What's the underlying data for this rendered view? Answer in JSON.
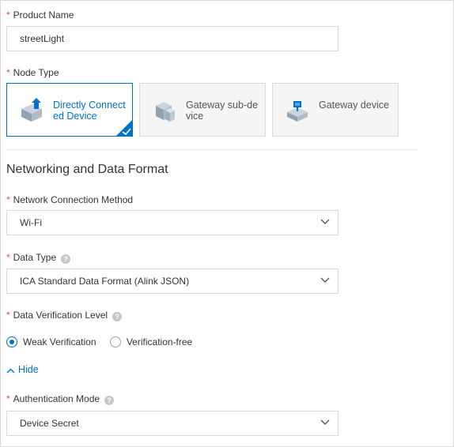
{
  "form": {
    "product_name": {
      "required_mark": "*",
      "label": "Product Name",
      "value": "streetLight"
    },
    "node_type": {
      "required_mark": "*",
      "label": "Node Type",
      "options": [
        {
          "label": "Directly Connected Device",
          "icon": "direct-device-icon",
          "selected": true
        },
        {
          "label": "Gateway sub-device",
          "icon": "gateway-subdevice-icon",
          "selected": false
        },
        {
          "label": "Gateway device",
          "icon": "gateway-device-icon",
          "selected": false
        }
      ]
    },
    "section_title": "Networking and Data Format",
    "network_connection": {
      "required_mark": "*",
      "label": "Network Connection Method",
      "value": "Wi-Fi"
    },
    "data_type": {
      "required_mark": "*",
      "label": "Data Type",
      "value": "ICA Standard Data Format (Alink JSON)",
      "help": "?"
    },
    "data_verification": {
      "required_mark": "*",
      "label": "Data Verification Level",
      "help": "?",
      "options": [
        {
          "label": "Weak Verification",
          "checked": true
        },
        {
          "label": "Verification-free",
          "checked": false
        }
      ]
    },
    "hide_link": "Hide",
    "authentication": {
      "required_mark": "*",
      "label": "Authentication Mode",
      "value": "Device Secret",
      "help": "?"
    }
  },
  "colors": {
    "accent": "#0070cc",
    "required": "#e84738",
    "border": "#d9d9d9",
    "card_bg": "#f5f5f5"
  }
}
